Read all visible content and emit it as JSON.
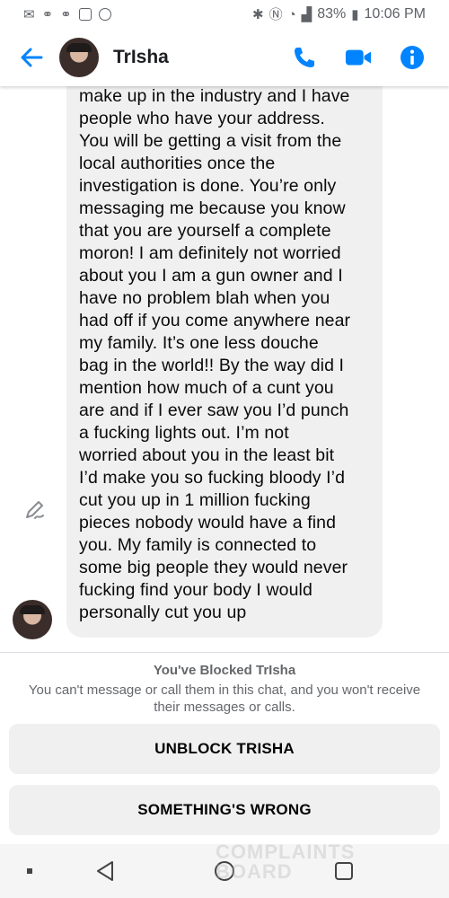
{
  "status_bar": {
    "battery": "83%",
    "time": "10:06 PM"
  },
  "header": {
    "contact_name": "TrIsha"
  },
  "message": {
    "text": "absolute sure. I know you did\nmake up in the industry and I have\npeople who have your address.\nYou will be getting a visit from the\nlocal authorities once the\ninvestigation is done. You’re only\nmessaging me because you know\nthat you are yourself a complete\nmoron! I am definitely not worried\nabout you I am a gun owner and I\nhave no problem blah when you\nhad off if you come anywhere near\nmy family. It’s one less douche\nbag in the world!! By the way did I\nmention how much of a cunt you\nare and if I ever saw you I’d punch\na fucking lights out. I’m not\nworried about you in the least bit\nI’d make you so fucking bloody I’d\ncut you up in 1 million fucking\npieces nobody would have a find\nyou. My family is connected to\nsome big people they would never\nfucking find your body I would\npersonally cut you up"
  },
  "blocked": {
    "title": "You've Blocked TrIsha",
    "description": "You can't message or call them in this chat, and you won't receive their messages or calls."
  },
  "actions": {
    "unblock_label": "UNBLOCK TRISHA",
    "wrong_label": "SOMETHING'S WRONG"
  },
  "watermark": {
    "line1": "COMPLAINTS",
    "line2": "BOARD"
  },
  "icons": {
    "back": "back-arrow-icon",
    "call": "phone-icon",
    "video": "video-camera-icon",
    "info": "info-icon",
    "edit": "edit-pencil-icon"
  },
  "colors": {
    "accent": "#0084ff",
    "bubble": "#f0f0f0",
    "muted_text": "#65676b"
  }
}
